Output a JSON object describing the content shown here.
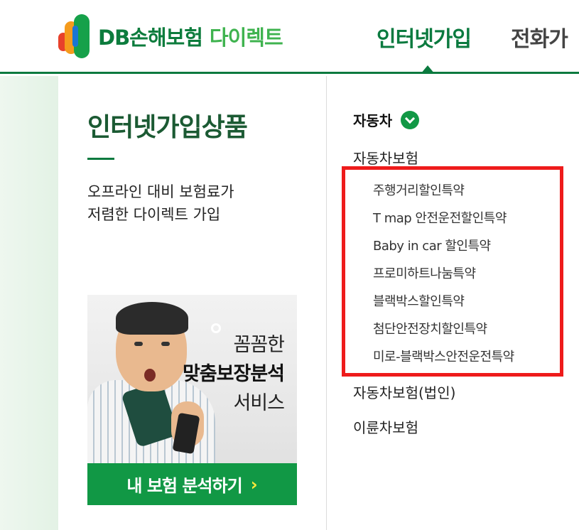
{
  "header": {
    "logo_text": "DB손해보험",
    "logo_sub": "다이렉트",
    "nav": {
      "active": "인터넷가입",
      "next": "전화가"
    },
    "colors": {
      "brand_green": "#0b7a3f",
      "accent_green": "#119845"
    }
  },
  "panel": {
    "title": "인터넷가입상품",
    "desc_line1": "오프라인 대비 보험료가",
    "desc_line2": "저렴한 다이렉트 가입"
  },
  "banner": {
    "line1": "꼼꼼한",
    "line2": "맞춤보장분석",
    "line3": "서비스",
    "button_label": "내 보험 분석하기",
    "button_chevron": "›"
  },
  "menu": {
    "category": "자동차",
    "category_icon": "check-circle-icon",
    "items": [
      {
        "label": "자동차보험"
      },
      {
        "label": "자동차보험(법인)"
      },
      {
        "label": "이륜차보험"
      }
    ],
    "sub_items": [
      {
        "label": "주행거리할인특약"
      },
      {
        "label": "T map 안전운전할인특약"
      },
      {
        "label": "Baby in car 할인특약"
      },
      {
        "label": "프로미하트나눔특약"
      },
      {
        "label": "블랙박스할인특약"
      },
      {
        "label": "첨단안전장치할인특약"
      },
      {
        "label": "미로-블랙박스안전운전특약"
      }
    ],
    "highlight_color": "#ee1b1b"
  }
}
